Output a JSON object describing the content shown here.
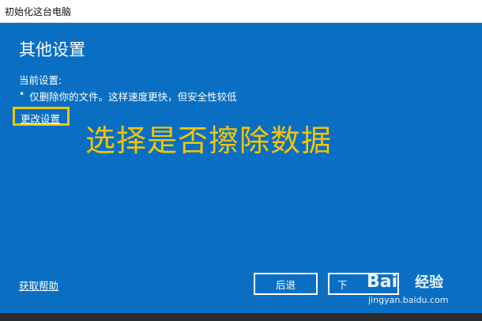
{
  "window": {
    "title": "初始化这台电脑"
  },
  "main": {
    "heading": "其他设置",
    "current_label": "当前设置:",
    "bullet": "•",
    "current_option": "仅删除你的文件。这样速度更快，但安全性较低",
    "change_settings_link": "更改设置",
    "help_link": "获取帮助"
  },
  "annotation": {
    "text": "选择是否擦除数据",
    "color": "#f5c400"
  },
  "buttons": {
    "back": "后退",
    "next": "下"
  },
  "watermark": {
    "logo_a": "Bai",
    "paw": "🐾",
    "logo_b": "经验",
    "url": "jingyan.baidu.com"
  },
  "colors": {
    "background": "#0a6fc2",
    "highlight": "#f5c400",
    "text": "#ffffff"
  }
}
